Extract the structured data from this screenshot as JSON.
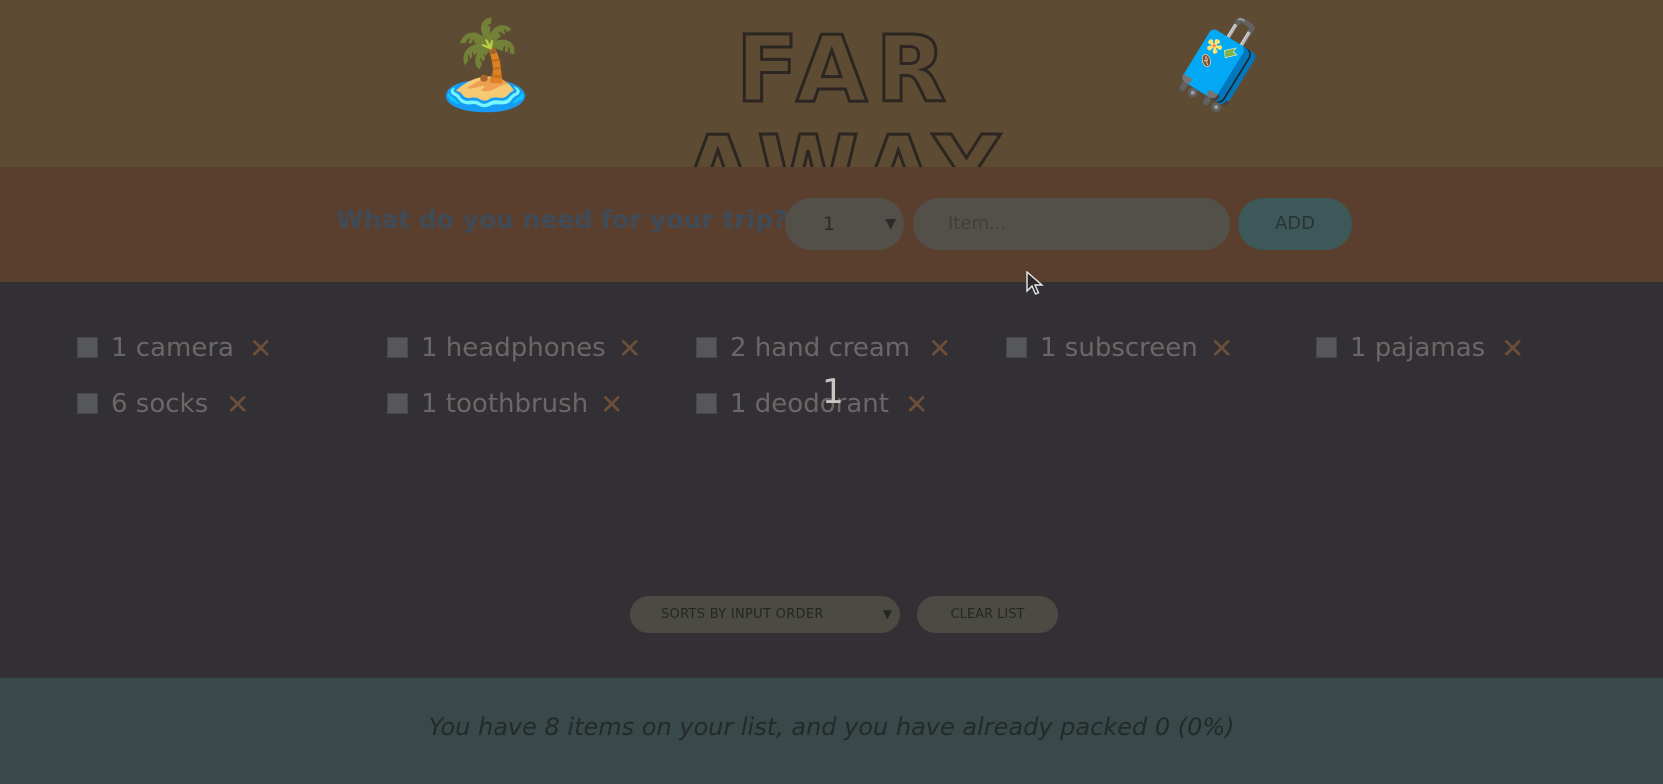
{
  "header": {
    "title": "FAR AWAY",
    "left_icon": "palm-island-icon",
    "right_icon": "suitcase-icon",
    "left_emoji": "🏝️",
    "right_emoji": "🧳"
  },
  "form": {
    "question": "What do you need for your trip?",
    "quantity_value": "1",
    "item_placeholder": "Item...",
    "add_label": "ADD"
  },
  "items": [
    {
      "label": "1 camera",
      "packed": false
    },
    {
      "label": "1 headphones",
      "packed": false
    },
    {
      "label": "2 hand cream",
      "packed": false
    },
    {
      "label": "1 subscreen",
      "packed": false
    },
    {
      "label": "1 pajamas",
      "packed": false
    },
    {
      "label": "6 socks",
      "packed": false
    },
    {
      "label": "1 toothbrush",
      "packed": false
    },
    {
      "label": "1 deodorant",
      "packed": false
    }
  ],
  "delete_glyph": "✕",
  "overlay_number": "1",
  "actions": {
    "sort_value": "SORTS BY INPUT ORDER",
    "clear_label": "CLEAR LIST"
  },
  "stats": {
    "text": "You have 8 items on your list, and you have already packed 0 (0%)"
  },
  "colors": {
    "header_bg": "#5e4b33",
    "form_bg": "#5a3f2f",
    "list_bg": "#323034",
    "stats_bg": "#394848",
    "delete_color": "#6e4e36"
  }
}
